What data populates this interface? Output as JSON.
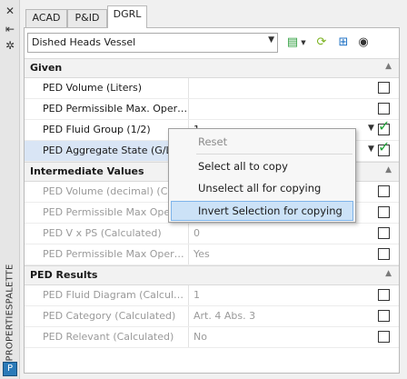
{
  "sidebar": {
    "title": "PROPERTIESPALETTE",
    "icons": [
      "close-icon",
      "auto-hide-icon",
      "settings-icon"
    ]
  },
  "tabs": [
    {
      "label": "ACAD",
      "active": false
    },
    {
      "label": "P&ID",
      "active": false
    },
    {
      "label": "DGRL",
      "active": true
    }
  ],
  "toolbar": {
    "object_type": "Dished Heads Vessel"
  },
  "categories": [
    {
      "label": "Given",
      "rows": [
        {
          "name": "PED Volume (Liters)",
          "value": "",
          "checked": false
        },
        {
          "name": "PED Permissible Max. Operating...",
          "value": "",
          "checked": false
        },
        {
          "name": "PED Fluid Group (1/2)",
          "value": "1",
          "checked": true
        },
        {
          "name": "PED Aggregate State (G/L)",
          "value": "",
          "checked": true
        }
      ]
    },
    {
      "label": "Intermediate Values",
      "rows": [
        {
          "name": "PED Volume (decimal) (Calculated)",
          "value": "",
          "checked": false
        },
        {
          "name": "PED Permissible Max Operating Pressure",
          "value": "",
          "checked": false
        },
        {
          "name": "PED V x PS (Calculated)",
          "value": "0",
          "checked": false
        },
        {
          "name": "PED Permissible Max Operating ...",
          "value": "Yes",
          "checked": false
        }
      ]
    },
    {
      "label": "PED Results",
      "rows": [
        {
          "name": "PED Fluid Diagram (Calculated)",
          "value": "1",
          "checked": false
        },
        {
          "name": "PED Category (Calculated)",
          "value": "Art. 4 Abs. 3",
          "checked": false
        },
        {
          "name": "PED Relevant (Calculated)",
          "value": "No",
          "checked": false
        }
      ]
    }
  ],
  "context_menu": {
    "items": [
      {
        "label": "Reset",
        "enabled": false
      },
      {
        "label": "Select all to copy",
        "enabled": true
      },
      {
        "label": "Unselect all for copying",
        "enabled": true
      },
      {
        "label": "Invert Selection for copying",
        "enabled": true,
        "highlighted": true
      }
    ]
  },
  "colors": {
    "check_green": "#22a33a",
    "selected_row": "#d9e5f5",
    "menu_highlight": "#cce2f7"
  }
}
